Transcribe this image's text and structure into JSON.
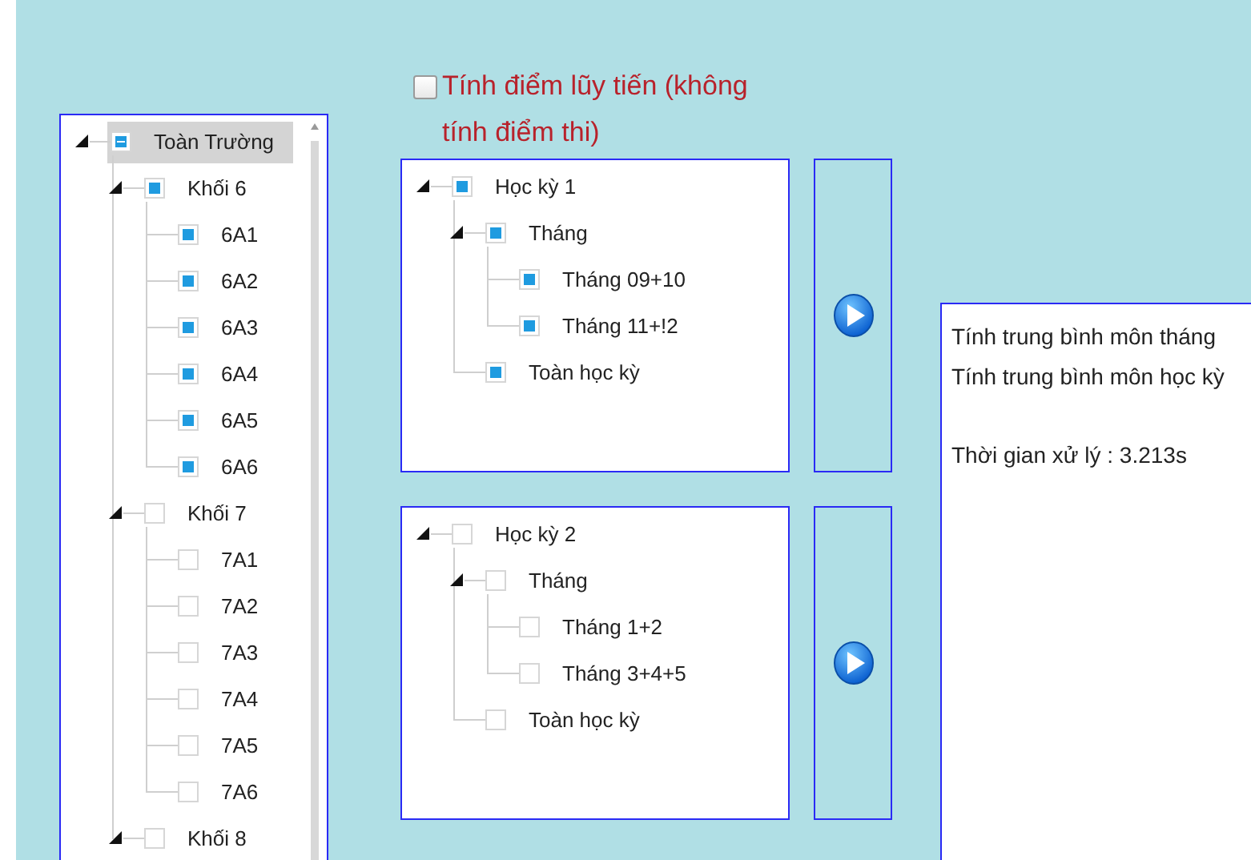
{
  "school_tree": {
    "nodes": [
      {
        "label": "Toàn Trường",
        "checked": true,
        "partial": true,
        "selected": true,
        "expanded": true,
        "children": [
          {
            "label": "Khối 6",
            "checked": true,
            "partial": false,
            "selected": false,
            "expanded": true,
            "children": [
              {
                "label": "6A1",
                "checked": true,
                "partial": false,
                "selected": false
              },
              {
                "label": "6A2",
                "checked": true,
                "partial": false,
                "selected": false
              },
              {
                "label": "6A3",
                "checked": true,
                "partial": false,
                "selected": false
              },
              {
                "label": "6A4",
                "checked": true,
                "partial": false,
                "selected": false
              },
              {
                "label": "6A5",
                "checked": true,
                "partial": false,
                "selected": false
              },
              {
                "label": "6A6",
                "checked": true,
                "partial": false,
                "selected": false
              }
            ]
          },
          {
            "label": "Khối 7",
            "checked": false,
            "partial": false,
            "selected": false,
            "expanded": true,
            "children": [
              {
                "label": "7A1",
                "checked": false,
                "partial": false,
                "selected": false
              },
              {
                "label": "7A2",
                "checked": false,
                "partial": false,
                "selected": false
              },
              {
                "label": "7A3",
                "checked": false,
                "partial": false,
                "selected": false
              },
              {
                "label": "7A4",
                "checked": false,
                "partial": false,
                "selected": false
              },
              {
                "label": "7A5",
                "checked": false,
                "partial": false,
                "selected": false
              },
              {
                "label": "7A6",
                "checked": false,
                "partial": false,
                "selected": false
              }
            ]
          },
          {
            "label": "Khối 8",
            "checked": false,
            "partial": false,
            "selected": false,
            "expanded": true
          }
        ]
      }
    ]
  },
  "option": {
    "label": "Tính điểm lũy tiến (không tính điểm thi)",
    "checked": false
  },
  "semesters": [
    {
      "nodes": [
        {
          "label": "Học kỳ 1",
          "checked": true,
          "partial": false,
          "selected": false,
          "expanded": true,
          "children": [
            {
              "label": "Tháng",
              "checked": true,
              "partial": false,
              "selected": false,
              "expanded": true,
              "children": [
                {
                  "label": "Tháng 09+10",
                  "checked": true,
                  "partial": false,
                  "selected": false
                },
                {
                  "label": "Tháng 11+!2",
                  "checked": true,
                  "partial": false,
                  "selected": false
                }
              ]
            },
            {
              "label": "Toàn học kỳ",
              "checked": true,
              "partial": false,
              "selected": false
            }
          ]
        }
      ]
    },
    {
      "nodes": [
        {
          "label": "Học kỳ 2",
          "checked": false,
          "partial": false,
          "selected": false,
          "expanded": true,
          "children": [
            {
              "label": "Tháng",
              "checked": false,
              "partial": false,
              "selected": false,
              "expanded": true,
              "children": [
                {
                  "label": "Tháng 1+2",
                  "checked": false,
                  "partial": false,
                  "selected": false
                },
                {
                  "label": "Tháng 3+4+5",
                  "checked": false,
                  "partial": false,
                  "selected": false
                }
              ]
            },
            {
              "label": "Toàn học kỳ",
              "checked": false,
              "partial": false,
              "selected": false
            }
          ]
        }
      ]
    }
  ],
  "result": {
    "lines": [
      "Tính trung bình môn tháng",
      "Tính trung bình môn học kỳ"
    ],
    "time": "Thời gian xử lý : 3.213s"
  }
}
